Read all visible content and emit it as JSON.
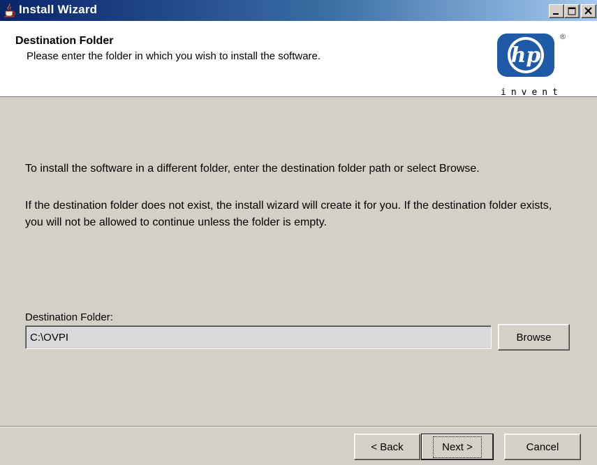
{
  "window": {
    "title": "Install Wizard"
  },
  "header": {
    "title": "Destination Folder",
    "subtitle": "Please enter the folder in which you wish to install the software.",
    "logo": {
      "mark": "hp",
      "tagline": "invent",
      "registered": "®",
      "color": "#1f5aa6"
    }
  },
  "body": {
    "paragraph1": "To install the software in a different folder, enter the destination folder path or select Browse.",
    "paragraph2": "If the destination folder does not exist, the install wizard will create it for you. If the destination folder exists, you will not be allowed to continue unless the folder is empty."
  },
  "destination": {
    "label": "Destination Folder:",
    "value": "C:\\OVPI",
    "browse_label": "Browse"
  },
  "footer": {
    "back_label": "< Back",
    "next_label": "Next >",
    "cancel_label": "Cancel"
  },
  "icons": [
    "java-cup-icon",
    "minimize-icon",
    "maximize-icon",
    "close-icon",
    "hp-logo"
  ]
}
